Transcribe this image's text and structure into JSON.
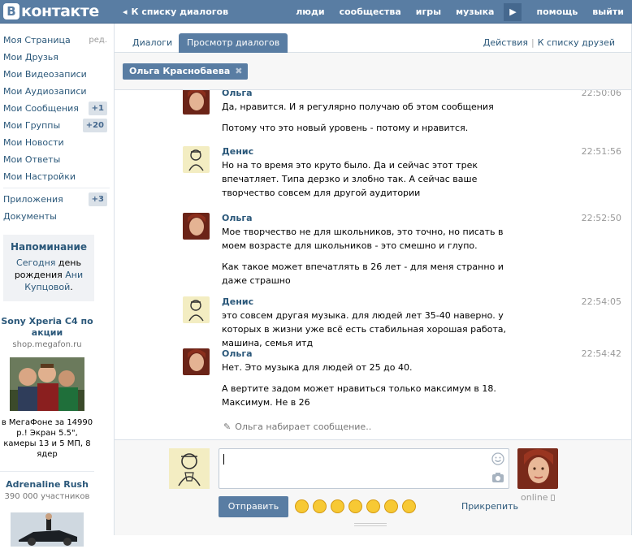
{
  "brand": {
    "logo_letter": "В",
    "name": "контакте"
  },
  "header": {
    "back_label": "К списку диалогов",
    "nav": [
      "люди",
      "сообщества",
      "игры",
      "музыка"
    ],
    "help": "помощь",
    "logout": "выйти"
  },
  "sidebar": {
    "items": [
      {
        "label": "Моя Страница",
        "extra": "ред."
      },
      {
        "label": "Мои Друзья"
      },
      {
        "label": "Мои Видеозаписи"
      },
      {
        "label": "Мои Аудиозаписи"
      },
      {
        "label": "Мои Сообщения",
        "badge": "+1"
      },
      {
        "label": "Мои Группы",
        "badge": "+20"
      },
      {
        "label": "Мои Новости"
      },
      {
        "label": "Мои Ответы"
      },
      {
        "label": "Мои Настройки"
      }
    ],
    "items2": [
      {
        "label": "Приложения",
        "badge": "+3"
      },
      {
        "label": "Документы"
      }
    ],
    "reminder": {
      "title": "Напоминание",
      "today": "Сегодня",
      "text1": "день",
      "text2": "рождения",
      "name1": "Ани",
      "name2": "Купцовой"
    },
    "ad1": {
      "title": "Sony Xperia C4 по акции",
      "domain": "shop.megafon.ru",
      "text": "в МегаФоне за 14990 р.! Экран 5.5\", камеры 13 и 5 МП, 8 ядер"
    },
    "ad2": {
      "title": "Adrenaline Rush",
      "sub": "390 000 участников"
    }
  },
  "tabs": {
    "dialogs": "Диалоги",
    "view": "Просмотр диалогов",
    "actions": "Действия",
    "to_friends": "К списку друзей"
  },
  "peer": {
    "name": "Ольга Краснобаева"
  },
  "messages": [
    {
      "author": "Ольга",
      "time": "22:50:06",
      "paras": [
        "Да, нравится. И я регулярно получаю об этом сообщения",
        "Потому что это новый уровень - потому и нравится."
      ]
    },
    {
      "author": "Денис",
      "time": "22:51:56",
      "paras": [
        "Но на то время это круто было. Да и сейчас этот трек впечатляет. Типа дерзко и злобно так. А сейчас ваше творчество совсем для другой аудитории"
      ]
    },
    {
      "author": "Ольга",
      "time": "22:52:50",
      "paras": [
        "Мое творчество не для школьников, это точно, но писать в моем возрасте для школьников - это смешно и глупо.",
        "Как такое может впечатлять в 26 лет - для меня странно и даже страшно"
      ]
    },
    {
      "author": "Денис",
      "time": "22:54:05",
      "paras": [
        "это совсем другая музыка. для людей лет 35-40 наверно. у которых в жизни уже всё есть стабильная хорошая работа, машина, семья итд"
      ]
    },
    {
      "author": "Ольга",
      "time": "22:54:42",
      "paras": [
        "Нет. Это музыка для людей от 25 до 40.",
        "А вертите задом может нравиться только максимум в 18. Максимум. Не в 26"
      ]
    }
  ],
  "typing": "Ольга набирает сообщение..",
  "compose": {
    "send": "Отправить",
    "attach": "Прикрепить",
    "status": "online"
  }
}
